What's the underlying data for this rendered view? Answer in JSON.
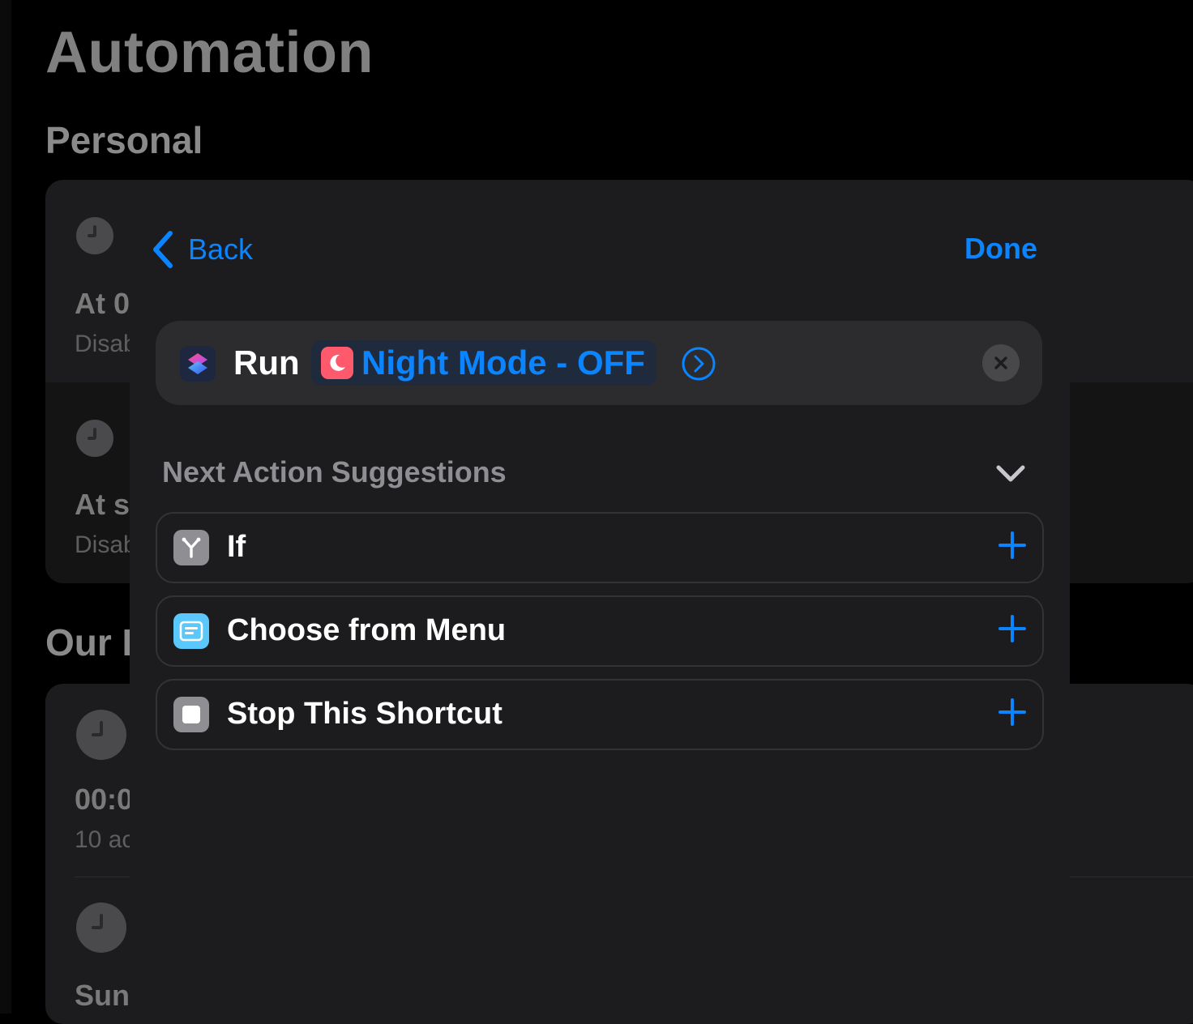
{
  "background": {
    "title": "Automation",
    "sections": [
      {
        "heading": "Personal",
        "rows": [
          {
            "title": "At 0",
            "subtitle": "Disab",
            "icon": "clock-icon"
          },
          {
            "title": "At s",
            "subtitle": "Disab",
            "icon": "clock-icon"
          }
        ]
      },
      {
        "heading": "Our I",
        "rows": [
          {
            "title": "00:0",
            "subtitle": "10 ac",
            "icon": "clock-icon"
          },
          {
            "title": "Sun",
            "subtitle": "",
            "icon": "clock-icon"
          }
        ]
      }
    ]
  },
  "sheet": {
    "nav": {
      "back_label": "Back",
      "done_label": "Done"
    },
    "action": {
      "verb": "Run",
      "shortcut_name": "Night Mode - OFF",
      "app_icon": "shortcuts-icon",
      "shortcut_icon": "moon-icon",
      "shortcut_icon_color": "#ff5a6b"
    },
    "suggestions": {
      "title": "Next Action Suggestions",
      "items": [
        {
          "label": "If",
          "icon": "if-branch-icon",
          "icon_color": "#8e8e93"
        },
        {
          "label": "Choose from Menu",
          "icon": "menu-icon",
          "icon_color": "#5ac8fa"
        },
        {
          "label": "Stop This Shortcut",
          "icon": "stop-icon",
          "icon_color": "#8e8e93"
        }
      ]
    }
  },
  "colors": {
    "accent": "#0a84ff",
    "sheet_bg": "#1c1c1e"
  }
}
